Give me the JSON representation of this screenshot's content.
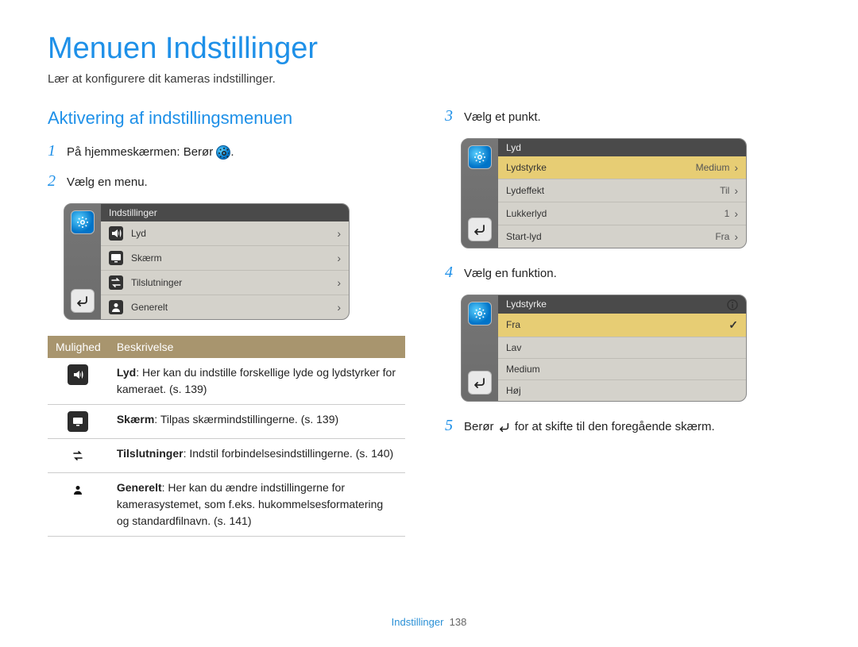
{
  "page": {
    "title": "Menuen Indstillinger",
    "subtitle": "Lær at konfigurere dit kameras indstillinger.",
    "section_title": "Aktivering af indstillingsmenuen",
    "footer_section": "Indstillinger",
    "footer_page": "138"
  },
  "steps": {
    "s1": "På hjemmeskærmen: Berør",
    "s1_after": ".",
    "s2": "Vælg en menu.",
    "s3": "Vælg et punkt.",
    "s4": "Vælg en funktion.",
    "s5a": "Berør",
    "s5b": "for at skifte til den foregående skærm."
  },
  "device1": {
    "header": "Indstillinger",
    "items": [
      {
        "icon": "speaker",
        "label": "Lyd"
      },
      {
        "icon": "monitor",
        "label": "Skærm"
      },
      {
        "icon": "swap",
        "label": "Tilslutninger"
      },
      {
        "icon": "user",
        "label": "Generelt"
      }
    ]
  },
  "device2": {
    "header": "Lyd",
    "items": [
      {
        "label": "Lydstyrke",
        "value": "Medium",
        "hl": true
      },
      {
        "label": "Lydeffekt",
        "value": "Til"
      },
      {
        "label": "Lukkerlyd",
        "value": "1"
      },
      {
        "label": "Start-lyd",
        "value": "Fra"
      }
    ]
  },
  "device3": {
    "header": "Lydstyrke",
    "items": [
      {
        "label": "Fra",
        "checked": true,
        "hl": true
      },
      {
        "label": "Lav"
      },
      {
        "label": "Medium"
      },
      {
        "label": "Høj"
      }
    ]
  },
  "table": {
    "head_opt": "Mulighed",
    "head_desc": "Beskrivelse",
    "rows": [
      {
        "icon": "speaker",
        "title": "Lyd",
        "desc": ": Her kan du indstille forskellige lyde og lydstyrker for kameraet. (s. 139)"
      },
      {
        "icon": "monitor",
        "title": "Skærm",
        "desc": ": Tilpas skærmindstillingerne. (s. 139)"
      },
      {
        "icon": "swap",
        "title": "Tilslutninger",
        "desc": ": Indstil forbindelsesindstillingerne. (s. 140)"
      },
      {
        "icon": "user",
        "title": "Generelt",
        "desc": ": Her kan du ændre indstillingerne for kamerasystemet, som f.eks. hukommelsesformatering og standardfilnavn. (s. 141)"
      }
    ]
  }
}
